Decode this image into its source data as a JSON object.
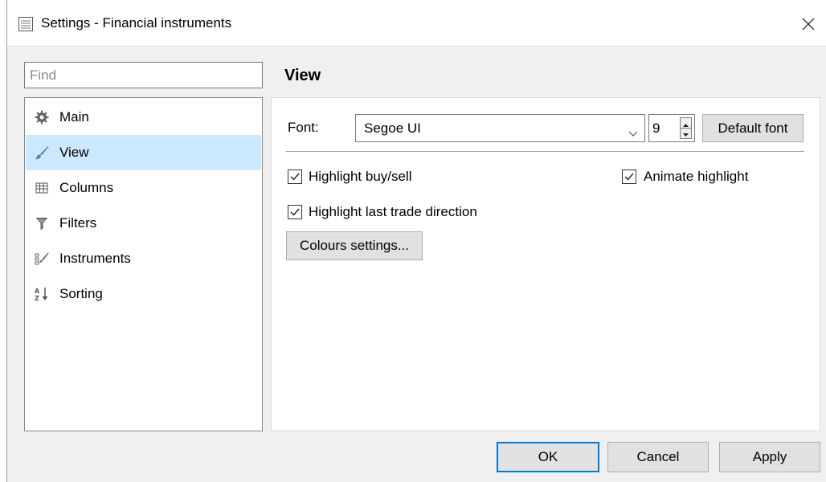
{
  "window": {
    "title": "Settings - Financial instruments"
  },
  "search": {
    "placeholder": "Find"
  },
  "nav": {
    "items": [
      {
        "label": "Main",
        "icon": "gear-icon"
      },
      {
        "label": "View",
        "icon": "brush-icon",
        "selected": true
      },
      {
        "label": "Columns",
        "icon": "columns-icon"
      },
      {
        "label": "Filters",
        "icon": "filter-icon"
      },
      {
        "label": "Instruments",
        "icon": "instruments-icon"
      },
      {
        "label": "Sorting",
        "icon": "sort-az-icon"
      }
    ]
  },
  "view": {
    "title": "View",
    "font_label": "Font:",
    "font_value": "Segoe UI",
    "font_size": "9",
    "default_font_label": "Default font",
    "highlight_buy_sell": {
      "label": "Highlight buy/sell",
      "checked": true
    },
    "animate_highlight": {
      "label": "Animate highlight",
      "checked": true
    },
    "highlight_last_trade": {
      "label": "Highlight last trade direction",
      "checked": true
    },
    "colours_settings_label": "Colours settings..."
  },
  "footer": {
    "ok": "OK",
    "cancel": "Cancel",
    "apply": "Apply"
  },
  "colors": {
    "selection": "#cce8ff",
    "accent": "#0078d7",
    "dialog_bg": "#f0f0f0"
  }
}
